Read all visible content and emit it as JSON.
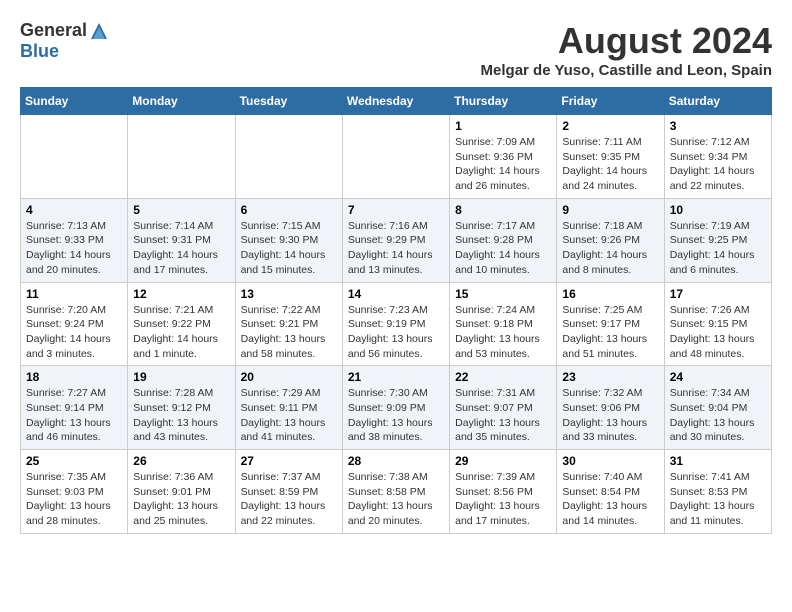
{
  "header": {
    "logo_general": "General",
    "logo_blue": "Blue",
    "month_title": "August 2024",
    "location": "Melgar de Yuso, Castille and Leon, Spain"
  },
  "days_of_week": [
    "Sunday",
    "Monday",
    "Tuesday",
    "Wednesday",
    "Thursday",
    "Friday",
    "Saturday"
  ],
  "weeks": [
    [
      {
        "day": "",
        "info": ""
      },
      {
        "day": "",
        "info": ""
      },
      {
        "day": "",
        "info": ""
      },
      {
        "day": "",
        "info": ""
      },
      {
        "day": "1",
        "info": "Sunrise: 7:09 AM\nSunset: 9:36 PM\nDaylight: 14 hours\nand 26 minutes."
      },
      {
        "day": "2",
        "info": "Sunrise: 7:11 AM\nSunset: 9:35 PM\nDaylight: 14 hours\nand 24 minutes."
      },
      {
        "day": "3",
        "info": "Sunrise: 7:12 AM\nSunset: 9:34 PM\nDaylight: 14 hours\nand 22 minutes."
      }
    ],
    [
      {
        "day": "4",
        "info": "Sunrise: 7:13 AM\nSunset: 9:33 PM\nDaylight: 14 hours\nand 20 minutes."
      },
      {
        "day": "5",
        "info": "Sunrise: 7:14 AM\nSunset: 9:31 PM\nDaylight: 14 hours\nand 17 minutes."
      },
      {
        "day": "6",
        "info": "Sunrise: 7:15 AM\nSunset: 9:30 PM\nDaylight: 14 hours\nand 15 minutes."
      },
      {
        "day": "7",
        "info": "Sunrise: 7:16 AM\nSunset: 9:29 PM\nDaylight: 14 hours\nand 13 minutes."
      },
      {
        "day": "8",
        "info": "Sunrise: 7:17 AM\nSunset: 9:28 PM\nDaylight: 14 hours\nand 10 minutes."
      },
      {
        "day": "9",
        "info": "Sunrise: 7:18 AM\nSunset: 9:26 PM\nDaylight: 14 hours\nand 8 minutes."
      },
      {
        "day": "10",
        "info": "Sunrise: 7:19 AM\nSunset: 9:25 PM\nDaylight: 14 hours\nand 6 minutes."
      }
    ],
    [
      {
        "day": "11",
        "info": "Sunrise: 7:20 AM\nSunset: 9:24 PM\nDaylight: 14 hours\nand 3 minutes."
      },
      {
        "day": "12",
        "info": "Sunrise: 7:21 AM\nSunset: 9:22 PM\nDaylight: 14 hours\nand 1 minute."
      },
      {
        "day": "13",
        "info": "Sunrise: 7:22 AM\nSunset: 9:21 PM\nDaylight: 13 hours\nand 58 minutes."
      },
      {
        "day": "14",
        "info": "Sunrise: 7:23 AM\nSunset: 9:19 PM\nDaylight: 13 hours\nand 56 minutes."
      },
      {
        "day": "15",
        "info": "Sunrise: 7:24 AM\nSunset: 9:18 PM\nDaylight: 13 hours\nand 53 minutes."
      },
      {
        "day": "16",
        "info": "Sunrise: 7:25 AM\nSunset: 9:17 PM\nDaylight: 13 hours\nand 51 minutes."
      },
      {
        "day": "17",
        "info": "Sunrise: 7:26 AM\nSunset: 9:15 PM\nDaylight: 13 hours\nand 48 minutes."
      }
    ],
    [
      {
        "day": "18",
        "info": "Sunrise: 7:27 AM\nSunset: 9:14 PM\nDaylight: 13 hours\nand 46 minutes."
      },
      {
        "day": "19",
        "info": "Sunrise: 7:28 AM\nSunset: 9:12 PM\nDaylight: 13 hours\nand 43 minutes."
      },
      {
        "day": "20",
        "info": "Sunrise: 7:29 AM\nSunset: 9:11 PM\nDaylight: 13 hours\nand 41 minutes."
      },
      {
        "day": "21",
        "info": "Sunrise: 7:30 AM\nSunset: 9:09 PM\nDaylight: 13 hours\nand 38 minutes."
      },
      {
        "day": "22",
        "info": "Sunrise: 7:31 AM\nSunset: 9:07 PM\nDaylight: 13 hours\nand 35 minutes."
      },
      {
        "day": "23",
        "info": "Sunrise: 7:32 AM\nSunset: 9:06 PM\nDaylight: 13 hours\nand 33 minutes."
      },
      {
        "day": "24",
        "info": "Sunrise: 7:34 AM\nSunset: 9:04 PM\nDaylight: 13 hours\nand 30 minutes."
      }
    ],
    [
      {
        "day": "25",
        "info": "Sunrise: 7:35 AM\nSunset: 9:03 PM\nDaylight: 13 hours\nand 28 minutes."
      },
      {
        "day": "26",
        "info": "Sunrise: 7:36 AM\nSunset: 9:01 PM\nDaylight: 13 hours\nand 25 minutes."
      },
      {
        "day": "27",
        "info": "Sunrise: 7:37 AM\nSunset: 8:59 PM\nDaylight: 13 hours\nand 22 minutes."
      },
      {
        "day": "28",
        "info": "Sunrise: 7:38 AM\nSunset: 8:58 PM\nDaylight: 13 hours\nand 20 minutes."
      },
      {
        "day": "29",
        "info": "Sunrise: 7:39 AM\nSunset: 8:56 PM\nDaylight: 13 hours\nand 17 minutes."
      },
      {
        "day": "30",
        "info": "Sunrise: 7:40 AM\nSunset: 8:54 PM\nDaylight: 13 hours\nand 14 minutes."
      },
      {
        "day": "31",
        "info": "Sunrise: 7:41 AM\nSunset: 8:53 PM\nDaylight: 13 hours\nand 11 minutes."
      }
    ]
  ]
}
